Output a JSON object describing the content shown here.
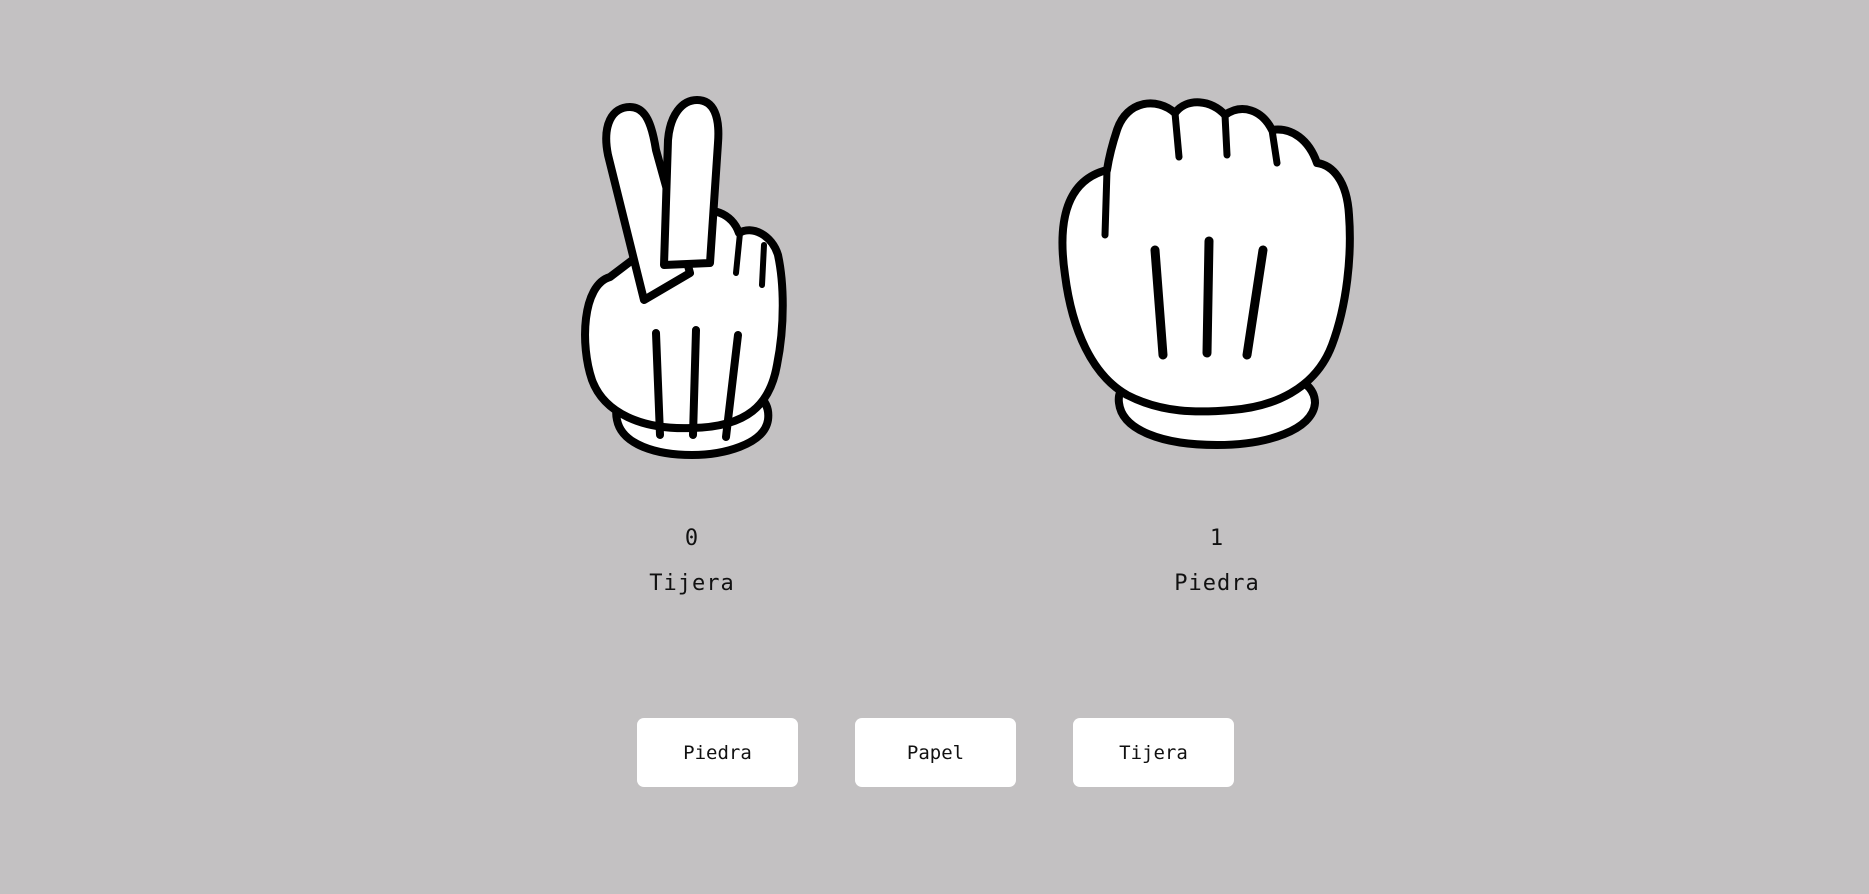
{
  "players": [
    {
      "score": "0",
      "choice": "Tijera",
      "hand_icon": "scissors-hand-icon"
    },
    {
      "score": "1",
      "choice": "Piedra",
      "hand_icon": "rock-hand-icon"
    }
  ],
  "buttons": {
    "rock": "Piedra",
    "paper": "Papel",
    "scissors": "Tijera"
  },
  "colors": {
    "background": "#c3c1c2",
    "button": "#ffffff",
    "outline": "#000000"
  }
}
